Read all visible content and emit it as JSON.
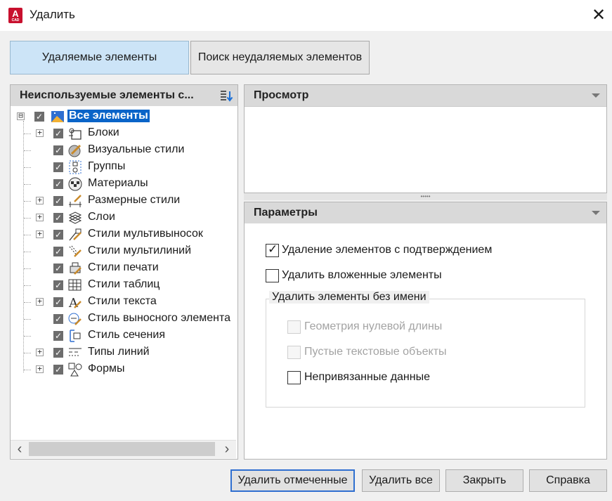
{
  "window": {
    "title": "Удалить",
    "app_icon_letter": "A",
    "app_icon_sub": "CAD",
    "close_glyph": "✕"
  },
  "tabs": [
    {
      "label": "Удаляемые элементы",
      "active": true
    },
    {
      "label": "Поиск неудаляемых элементов",
      "active": false
    }
  ],
  "tree_panel": {
    "title": "Неиспользуемые элементы с...",
    "root": {
      "label": "Все элементы",
      "expander": "⊟",
      "checked": true,
      "icon": "all-items-icon"
    },
    "items": [
      {
        "label": "Блоки",
        "expandable": true,
        "checked": true,
        "icon": "block-icon"
      },
      {
        "label": "Визуальные стили",
        "expandable": false,
        "checked": true,
        "icon": "visual-style-icon"
      },
      {
        "label": "Группы",
        "expandable": false,
        "checked": true,
        "icon": "group-icon"
      },
      {
        "label": "Материалы",
        "expandable": false,
        "checked": true,
        "icon": "material-icon"
      },
      {
        "label": "Размерные стили",
        "expandable": true,
        "checked": true,
        "icon": "dimension-style-icon"
      },
      {
        "label": "Слои",
        "expandable": true,
        "checked": true,
        "icon": "layer-icon"
      },
      {
        "label": "Стили мультивыносок",
        "expandable": true,
        "checked": true,
        "icon": "multileader-style-icon"
      },
      {
        "label": "Стили мультилиний",
        "expandable": false,
        "checked": true,
        "icon": "multiline-style-icon"
      },
      {
        "label": "Стили печати",
        "expandable": false,
        "checked": true,
        "icon": "plot-style-icon"
      },
      {
        "label": "Стили таблиц",
        "expandable": false,
        "checked": true,
        "icon": "table-style-icon"
      },
      {
        "label": "Стили текста",
        "expandable": true,
        "checked": true,
        "icon": "text-style-icon"
      },
      {
        "label": "Стиль выносного элемента",
        "expandable": false,
        "checked": true,
        "icon": "detail-view-style-icon"
      },
      {
        "label": "Стиль сечения",
        "expandable": false,
        "checked": true,
        "icon": "section-view-style-icon"
      },
      {
        "label": "Типы линий",
        "expandable": true,
        "checked": true,
        "icon": "linetype-icon"
      },
      {
        "label": "Формы",
        "expandable": true,
        "checked": true,
        "icon": "shape-icon"
      }
    ],
    "scroll_left": "‹",
    "scroll_right": "›"
  },
  "preview_panel": {
    "title": "Просмотр"
  },
  "splitter_grip": "•••••",
  "params_panel": {
    "title": "Параметры",
    "options": [
      {
        "label": "Удаление элементов с подтверждением",
        "checked": true,
        "disabled": false
      },
      {
        "label": "Удалить вложенные элементы",
        "checked": false,
        "disabled": false
      }
    ],
    "group_title": "Удалить элементы без имени",
    "group_options": [
      {
        "label": "Геометрия нулевой длины",
        "checked": false,
        "disabled": true
      },
      {
        "label": "Пустые текстовые объекты",
        "checked": false,
        "disabled": true
      },
      {
        "label": "Непривязанные данные",
        "checked": false,
        "disabled": false
      }
    ]
  },
  "buttons": {
    "purge_checked": "Удалить отмеченные",
    "purge_all": "Удалить все",
    "close": "Закрыть",
    "help": "Справка"
  },
  "colors": {
    "accent": "#0a64c8",
    "tab_active": "#cce4f7",
    "brand": "#c8102e"
  }
}
